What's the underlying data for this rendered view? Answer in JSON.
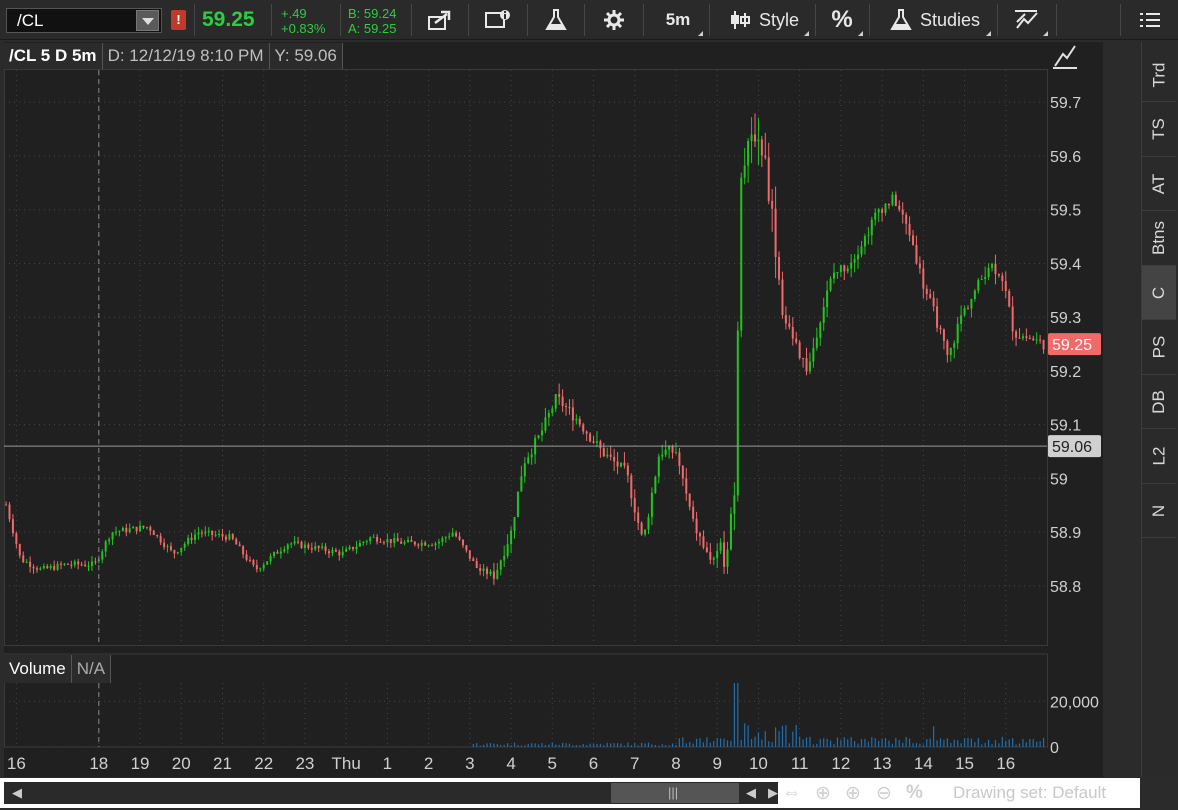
{
  "toolbar": {
    "symbol": "/CL",
    "alert_glyph": "!",
    "last_price": "59.25",
    "net_change": "+.49",
    "pct_change": "+0.83%",
    "bid": "B: 59.24",
    "ask": "A: 59.25",
    "timeframe": "5m",
    "style_label": "Style",
    "percent_label": "%",
    "studies_label": "Studies"
  },
  "chart_header": {
    "symbol_period": "/CL 5 D 5m",
    "date": "D: 12/12/19 8:10 PM",
    "y_value": "Y: 59.06"
  },
  "volume_header": {
    "title": "Volume",
    "value": "N/A"
  },
  "side_tabs": [
    "Trd",
    "TS",
    "AT",
    "Btns",
    "C",
    "PS",
    "DB",
    "L2",
    "N"
  ],
  "bottom": {
    "drawing_set": "Drawing set: Default"
  },
  "colors": {
    "up": "#22c41e",
    "down": "#f06a6a",
    "volume": "#1f6fb0",
    "last_price_badge": "#f06a6a",
    "crosshair_badge": "#d0d0d0"
  },
  "chart_data": {
    "type": "candlestick",
    "price_ticks": [
      58.8,
      58.9,
      59.0,
      59.1,
      59.2,
      59.3,
      59.4,
      59.5,
      59.6,
      59.7
    ],
    "price_tick_labels": [
      "58.8",
      "58.9",
      "59",
      "59.1",
      "59.2",
      "59.3",
      "59.4",
      "59.5",
      "59.6",
      "59.7"
    ],
    "ylim": [
      58.69,
      59.76
    ],
    "last_price": 59.25,
    "last_price_label": "59.25",
    "crosshair_price": 59.06,
    "crosshair_price_label": "59.06",
    "x_tick_labels": [
      "16",
      "18",
      "19",
      "20",
      "21",
      "22",
      "23",
      "Thu",
      "1",
      "2",
      "3",
      "4",
      "5",
      "6",
      "7",
      "8",
      "9",
      "10",
      "11",
      "12",
      "13",
      "14",
      "15",
      "16"
    ],
    "x_tick_hours": [
      16,
      18,
      19,
      20,
      21,
      22,
      23,
      24,
      25,
      26,
      27,
      28,
      29,
      30,
      31,
      32,
      33,
      34,
      35,
      36,
      37,
      38,
      39,
      40
    ],
    "x_range_hours": [
      15.7,
      41.0
    ],
    "crosshair_hour": 18,
    "volume_tick_labels": [
      "20,000",
      "0"
    ],
    "volume_ticks": [
      20000,
      0
    ],
    "volume_max": 28000,
    "price_path": [
      [
        15.72,
        58.96
      ],
      [
        16.1,
        58.85
      ],
      [
        16.6,
        58.83
      ],
      [
        17.2,
        58.84
      ],
      [
        17.9,
        58.84
      ],
      [
        18.3,
        58.9
      ],
      [
        19.2,
        58.91
      ],
      [
        19.8,
        58.86
      ],
      [
        20.4,
        58.9
      ],
      [
        21.2,
        58.89
      ],
      [
        21.8,
        58.83
      ],
      [
        22.6,
        58.88
      ],
      [
        23.3,
        58.87
      ],
      [
        23.9,
        58.86
      ],
      [
        24.6,
        58.89
      ],
      [
        25.4,
        58.88
      ],
      [
        26.2,
        58.88
      ],
      [
        26.6,
        58.9
      ],
      [
        27.2,
        58.83
      ],
      [
        27.6,
        58.82
      ],
      [
        28.0,
        58.9
      ],
      [
        28.3,
        59.03
      ],
      [
        28.7,
        59.08
      ],
      [
        29.1,
        59.15
      ],
      [
        29.6,
        59.11
      ],
      [
        30.2,
        59.05
      ],
      [
        30.8,
        59.01
      ],
      [
        31.2,
        58.88
      ],
      [
        31.6,
        59.05
      ],
      [
        32.0,
        59.05
      ],
      [
        32.4,
        58.92
      ],
      [
        32.8,
        58.85
      ],
      [
        33.2,
        58.86
      ],
      [
        33.45,
        59.0
      ],
      [
        33.55,
        59.55
      ],
      [
        33.9,
        59.65
      ],
      [
        34.15,
        59.6
      ],
      [
        34.35,
        59.48
      ],
      [
        34.6,
        59.3
      ],
      [
        34.9,
        59.25
      ],
      [
        35.2,
        59.2
      ],
      [
        35.5,
        59.3
      ],
      [
        35.8,
        59.38
      ],
      [
        36.2,
        59.4
      ],
      [
        36.6,
        59.45
      ],
      [
        36.9,
        59.5
      ],
      [
        37.3,
        59.52
      ],
      [
        37.7,
        59.45
      ],
      [
        38.0,
        59.36
      ],
      [
        38.3,
        59.3
      ],
      [
        38.6,
        59.22
      ],
      [
        38.9,
        59.3
      ],
      [
        39.2,
        59.34
      ],
      [
        39.6,
        59.4
      ],
      [
        39.9,
        59.38
      ],
      [
        40.2,
        59.27
      ],
      [
        40.6,
        59.26
      ],
      [
        40.95,
        59.25
      ]
    ]
  }
}
